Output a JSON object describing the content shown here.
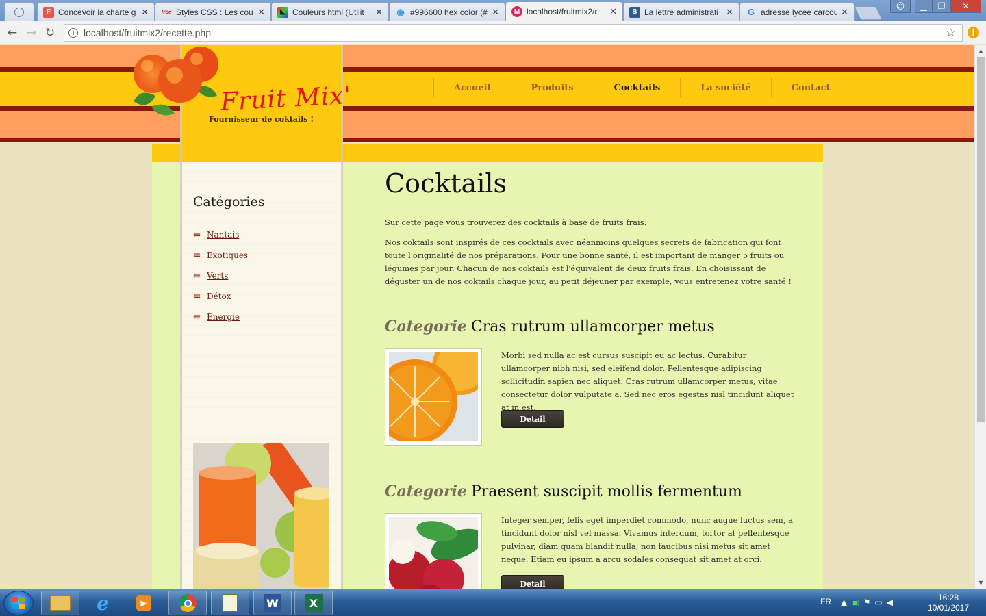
{
  "browser": {
    "tabs": [
      {
        "label": "Concevoir la charte g",
        "icon": "F",
        "icon_color": "#e8554b"
      },
      {
        "label": "Styles CSS : Les coul",
        "icon": "free",
        "icon_color": "#d01f1f"
      },
      {
        "label": "Couleurs html (Utilit",
        "icon": "◣",
        "icon_color": "#222222"
      },
      {
        "label": "#996600 hex color (#",
        "icon": "◉",
        "icon_color": "#3a9fd6"
      },
      {
        "label": "localhost/fruitmix2/r",
        "icon": "M",
        "icon_color": "#e0245e"
      },
      {
        "label": "La lettre administrati",
        "icon": "B",
        "icon_color": "#2f5a8c"
      },
      {
        "label": "adresse lycee carcou",
        "icon": "G",
        "icon_color": "#4285f4"
      }
    ],
    "url": "localhost/fruitmix2/recette.php"
  },
  "site": {
    "brand": "Fruit Mix'",
    "tagline": "Fournisseur de coktails !",
    "nav": [
      "Accueil",
      "Produits",
      "Cocktails",
      "La société",
      "Contact"
    ],
    "current_nav": "Cocktails"
  },
  "sidebar": {
    "title": "Catégories",
    "items": [
      "Nantais",
      "Exotiques",
      "Verts",
      "Détox",
      "Energie"
    ]
  },
  "main": {
    "title": "Cocktails",
    "intro_1": "Sur cette page vous trouverez des cocktails à base de fruits frais.",
    "intro_2": "Nos coktails sont inspirés de ces cocktails avec néanmoins quelques secrets de fabrication qui font toute l'originalité de nos préparations. Pour une bonne santé, il est important de manger 5 fruits ou légumes par jour. Chacun de nos coktails est l'équivalent de deux fruits frais. En choisissant de déguster un de nos coktails chaque jour, au petit déjeuner par exemple, vous entretenez votre santé !",
    "sections": [
      {
        "category_word": "Categorie",
        "title": "Cras rutrum ullamcorper metus",
        "text": "Morbi sed nulla ac est cursus suscipit eu ac lectus. Curabitur ullamcorper nibh nisi, sed eleifend dolor. Pellentesque adipiscing sollicitudin sapien nec aliquet. Cras rutrum ullamcorper metus, vitae consectetur dolor vulputate a. Sed nec eros egestas nisl tincidunt aliquet at in est.",
        "button": "Detail"
      },
      {
        "category_word": "Categorie",
        "title": "Praesent suscipit mollis fermentum",
        "text": "Integer semper, felis eget imperdiet commodo, nunc augue luctus sem, a tincidunt dolor nisl vel massa. Vivamus interdum, tortor at pellentesque pulvinar, diam quam blandit nulla, non faucibus nisi metus sit amet neque. Etiam eu ipsum a arcu sodales consequat sit amet at orci.",
        "button": "Detail"
      }
    ]
  },
  "taskbar": {
    "language": "FR",
    "time": "16:28",
    "date": "10/01/2017"
  },
  "colors": {
    "peach": "#ff9e5e",
    "dark_red": "#8a1a08",
    "yellow": "#ffc90f",
    "page_green": "#e6f5b0",
    "background_beige": "#ebe2c0"
  }
}
